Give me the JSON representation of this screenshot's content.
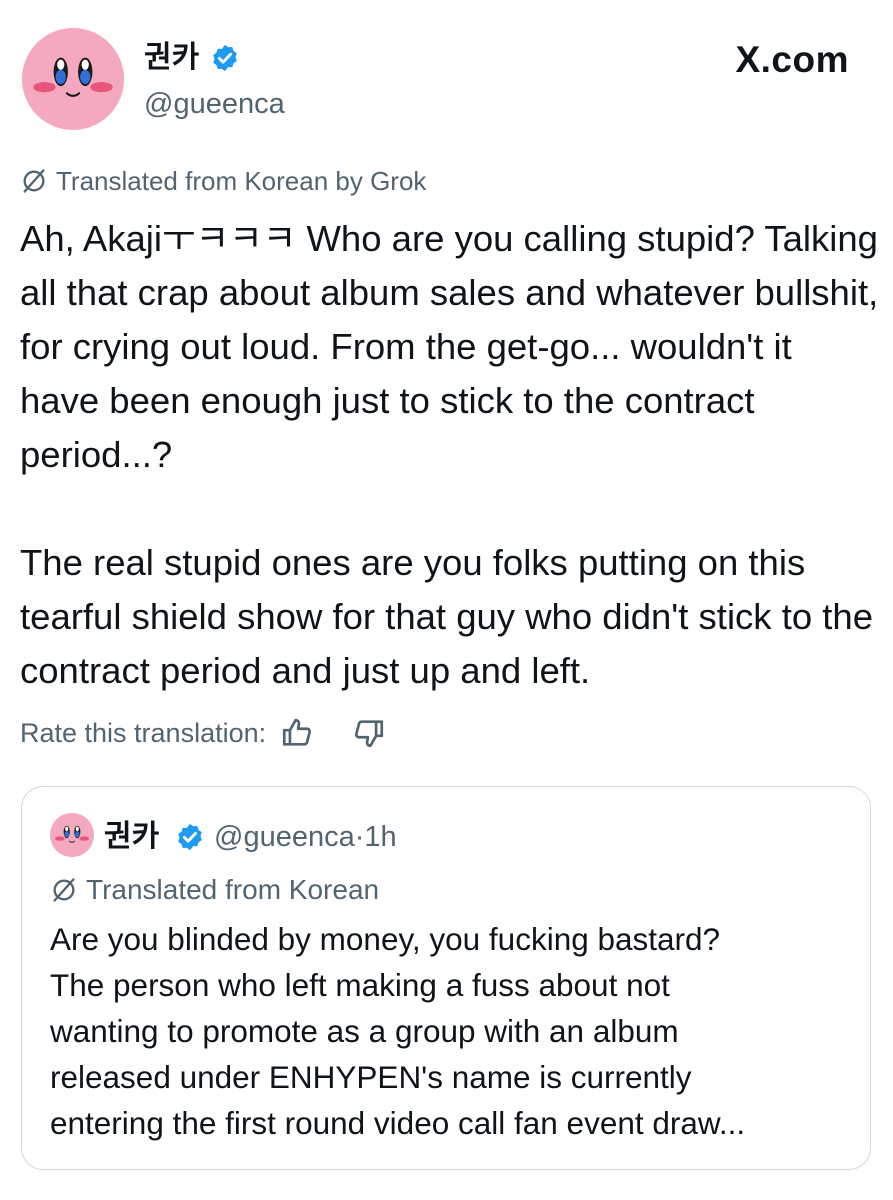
{
  "tweet": {
    "display_name": "권카",
    "handle": "@gueenca",
    "brand": "X.com",
    "translated_label": "Translated from Korean by Grok",
    "text_paragraphs": [
      "Ah, Akajiㅜㅋㅋㅋ Who are you calling stupid? Talking all that crap about album sales and whatever bullshit, for crying out loud. From the get-go... wouldn't it have been enough just to stick to the contract period...?",
      "The real stupid ones are you folks putting on this tearful shield show for that guy who didn't stick to the contract period and just up and left."
    ],
    "rate_label": "Rate this translation:",
    "icons": {
      "avatar": "kirby-avatar-icon",
      "verified": "verified-badge-icon",
      "translate": "translate-icon",
      "thumbs_up": "thumbs-up-icon",
      "thumbs_down": "thumbs-down-icon"
    },
    "colors": {
      "verified": "#1d9bf0",
      "secondary_text": "#536471",
      "avatar_bg": "#f4a9bf"
    }
  },
  "quote": {
    "display_name": "권카",
    "handle": "@gueenca",
    "separator": "·",
    "time": "1h",
    "translated_label": "Translated from Korean",
    "text_lines": [
      "Are you blinded by money, you fucking bastard?",
      "The person who left making a fuss about not",
      "wanting to promote as a group with an album",
      "released under ENHYPEN's name is currently",
      "entering the first round video call fan event draw..."
    ]
  }
}
